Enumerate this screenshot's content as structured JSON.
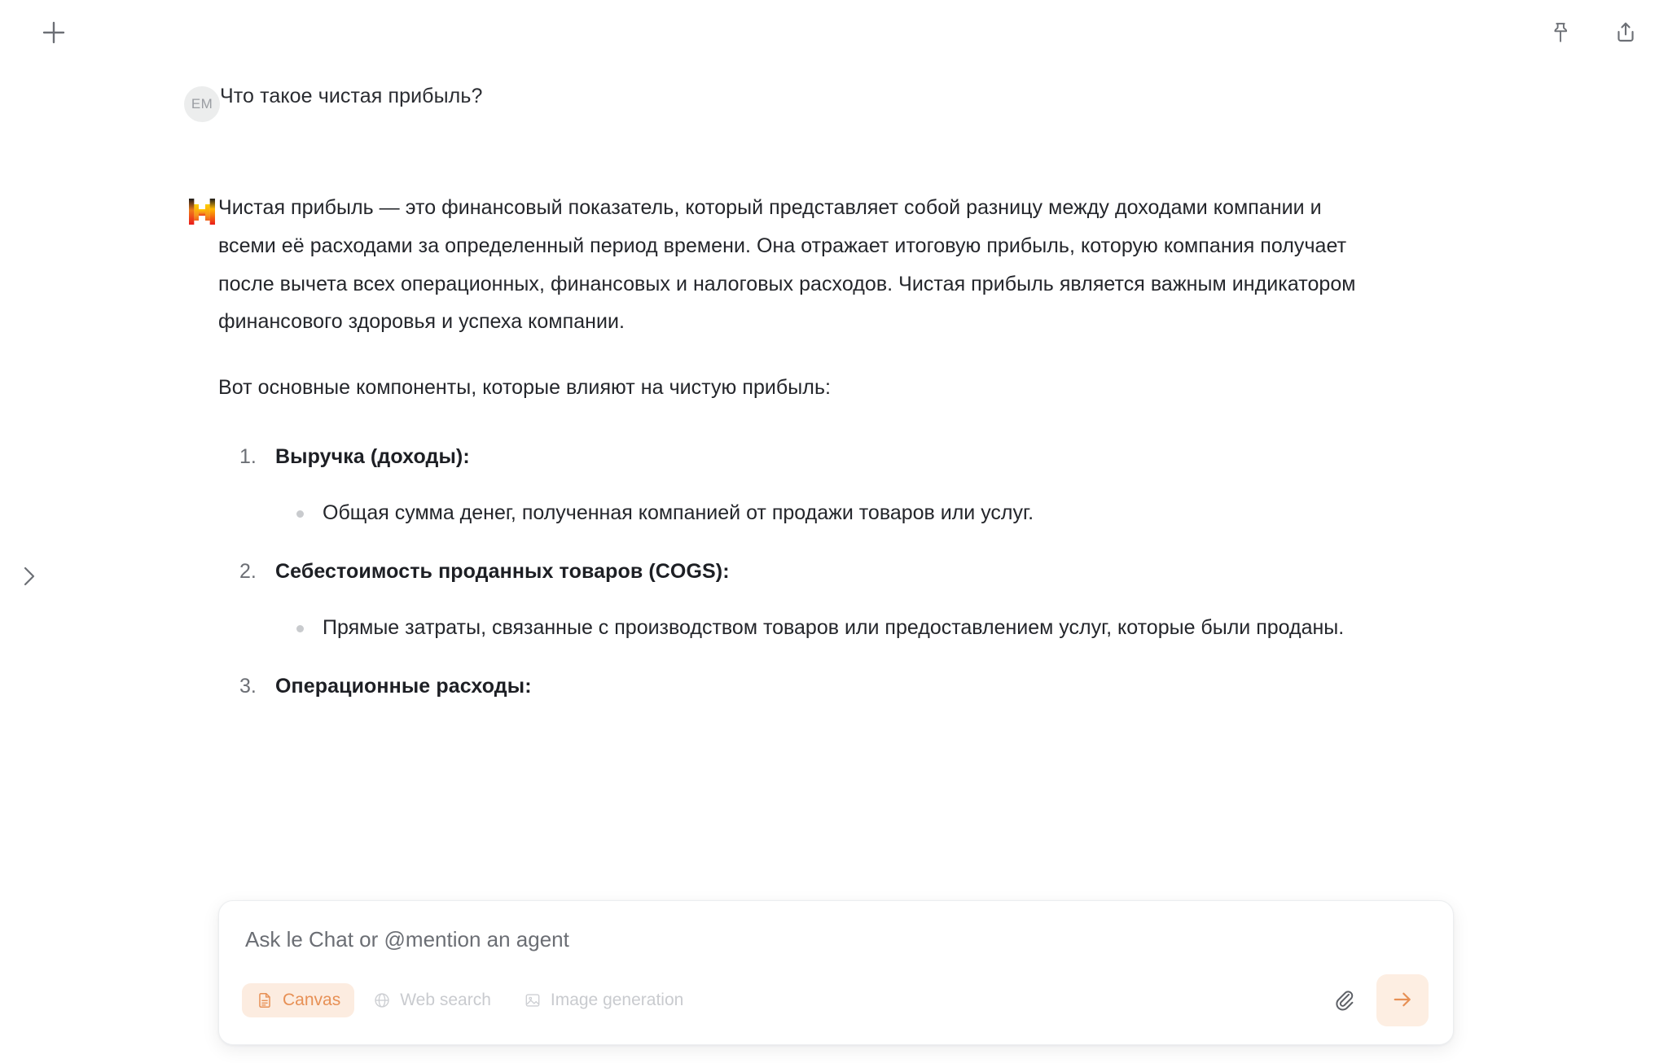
{
  "header": {
    "new_chat_label": "new-chat",
    "pin_label": "pin-conversation",
    "share_label": "share-conversation"
  },
  "sidebar": {
    "toggle_label": "expand-sidebar"
  },
  "conversation": {
    "user": {
      "avatar_initials": "EM",
      "message": "Что такое чистая прибыль?"
    },
    "assistant": {
      "brand": "le-chat",
      "paragraphs": [
        "Чистая прибыль — это финансовый показатель, который представляет собой разницу между доходами компании и всеми её расходами за определенный период времени. Она отражает итоговую прибыль, которую компания получает после вычета всех операционных, финансовых и налоговых расходов. Чистая прибыль является важным индикатором финансового здоровья и успеха компании.",
        "Вот основные компоненты, которые влияют на чистую прибыль:"
      ],
      "list": [
        {
          "title": "Выручка (доходы):",
          "bullets": [
            "Общая сумма денег, полученная компанией от продажи товаров или услуг."
          ]
        },
        {
          "title": "Себестоимость проданных товаров (COGS):",
          "bullets": [
            "Прямые затраты, связанные с производством товаров или предоставлением услуг, которые были проданы."
          ]
        },
        {
          "title": "Операционные расходы:",
          "bullets": []
        }
      ]
    }
  },
  "composer": {
    "placeholder": "Ask le Chat or @mention an agent",
    "value": "",
    "tools": [
      {
        "label": "Canvas",
        "icon": "document-icon",
        "state": "active"
      },
      {
        "label": "Web search",
        "icon": "globe-icon",
        "state": "muted"
      },
      {
        "label": "Image generation",
        "icon": "image-icon",
        "state": "muted"
      }
    ],
    "attach_label": "attach-file",
    "send_label": "send-message"
  },
  "colors": {
    "accent": "#e79055",
    "accent_soft": "#fcece0",
    "send_bg": "#fdeee2",
    "text": "#24262b",
    "muted": "#c9cbcf",
    "avatar_bg": "#eceded"
  }
}
